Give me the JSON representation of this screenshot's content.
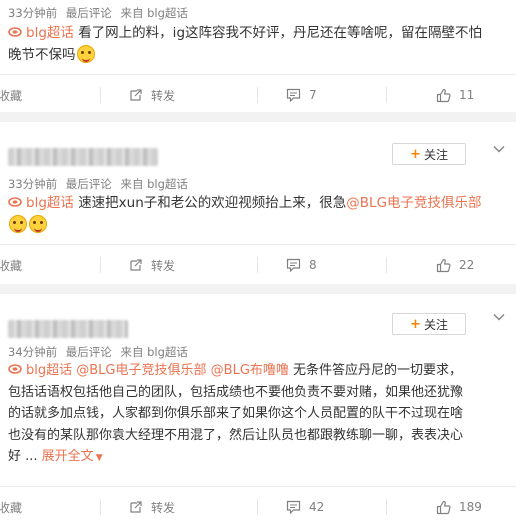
{
  "posts": [
    {
      "meta": {
        "time": "33分钟前",
        "source_type": "最后评论",
        "source": "来自 blg超话"
      },
      "topic": "blg超话",
      "text_before": "看了网上的料，ig这阵容我不好评，丹尼还在等啥呢，留在隔壁不怕",
      "text_line2": "晚节不保吗",
      "emoji": "laughing-emoji",
      "actions": {
        "favorite": "收藏",
        "repost": "转发",
        "comments": "7",
        "likes": "11"
      }
    },
    {
      "follow_label": "关注",
      "meta": {
        "time": "33分钟前",
        "source_type": "最后评论",
        "source": "来自 blg超话"
      },
      "topic": "blg超话",
      "text_before": "速速把xun子和老公的欢迎视频抬上来，很急",
      "mention": "@BLG电子竞技俱乐部",
      "emoji": "cheer-emoji",
      "actions": {
        "favorite": "收藏",
        "repost": "转发",
        "comments": "8",
        "likes": "22"
      }
    },
    {
      "follow_label": "关注",
      "meta": {
        "time": "34分钟前",
        "source_type": "最后评论",
        "source": "来自 blg超话"
      },
      "topic": "blg超话",
      "mention1": "@BLG电子竞技俱乐部",
      "mention2": "@BLG布噜噜",
      "text_line1_tail": "无条件答应丹尼的一切要求，",
      "text_line2": "包括话语权包括他自己的团队，包括成绩也不要他负责不要对赌，如果他还犹豫",
      "text_line3": "的话就多加点钱，人家都到你俱乐部来了如果你这个人员配置的队干不过现在啥",
      "text_line4": "也没有的某队那你袁大经理不用混了，然后让队员也都跟教练聊一聊，表表决心",
      "text_line5": "好 ...",
      "expand_label": "展开全文",
      "actions": {
        "favorite": "收藏",
        "repost": "转发",
        "comments": "42",
        "likes": "189"
      }
    }
  ]
}
